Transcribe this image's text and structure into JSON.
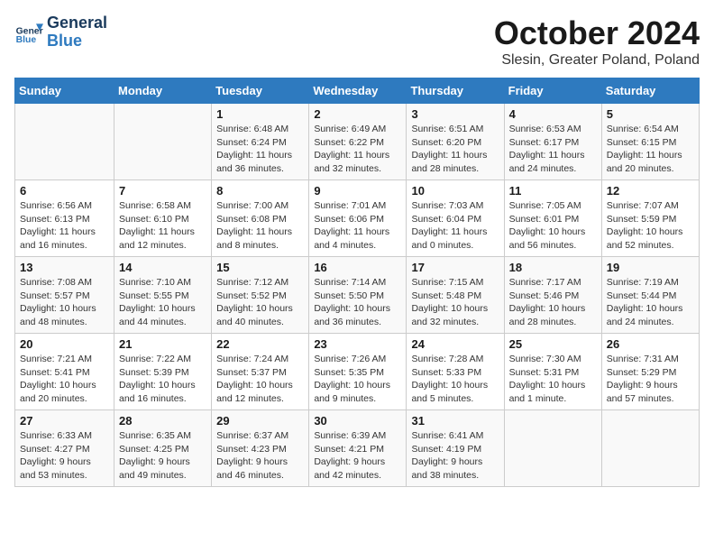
{
  "header": {
    "logo_line1": "General",
    "logo_line2": "Blue",
    "month": "October 2024",
    "location": "Slesin, Greater Poland, Poland"
  },
  "days_of_week": [
    "Sunday",
    "Monday",
    "Tuesday",
    "Wednesday",
    "Thursday",
    "Friday",
    "Saturday"
  ],
  "weeks": [
    [
      {
        "day": "",
        "info": ""
      },
      {
        "day": "",
        "info": ""
      },
      {
        "day": "1",
        "info": "Sunrise: 6:48 AM\nSunset: 6:24 PM\nDaylight: 11 hours and 36 minutes."
      },
      {
        "day": "2",
        "info": "Sunrise: 6:49 AM\nSunset: 6:22 PM\nDaylight: 11 hours and 32 minutes."
      },
      {
        "day": "3",
        "info": "Sunrise: 6:51 AM\nSunset: 6:20 PM\nDaylight: 11 hours and 28 minutes."
      },
      {
        "day": "4",
        "info": "Sunrise: 6:53 AM\nSunset: 6:17 PM\nDaylight: 11 hours and 24 minutes."
      },
      {
        "day": "5",
        "info": "Sunrise: 6:54 AM\nSunset: 6:15 PM\nDaylight: 11 hours and 20 minutes."
      }
    ],
    [
      {
        "day": "6",
        "info": "Sunrise: 6:56 AM\nSunset: 6:13 PM\nDaylight: 11 hours and 16 minutes."
      },
      {
        "day": "7",
        "info": "Sunrise: 6:58 AM\nSunset: 6:10 PM\nDaylight: 11 hours and 12 minutes."
      },
      {
        "day": "8",
        "info": "Sunrise: 7:00 AM\nSunset: 6:08 PM\nDaylight: 11 hours and 8 minutes."
      },
      {
        "day": "9",
        "info": "Sunrise: 7:01 AM\nSunset: 6:06 PM\nDaylight: 11 hours and 4 minutes."
      },
      {
        "day": "10",
        "info": "Sunrise: 7:03 AM\nSunset: 6:04 PM\nDaylight: 11 hours and 0 minutes."
      },
      {
        "day": "11",
        "info": "Sunrise: 7:05 AM\nSunset: 6:01 PM\nDaylight: 10 hours and 56 minutes."
      },
      {
        "day": "12",
        "info": "Sunrise: 7:07 AM\nSunset: 5:59 PM\nDaylight: 10 hours and 52 minutes."
      }
    ],
    [
      {
        "day": "13",
        "info": "Sunrise: 7:08 AM\nSunset: 5:57 PM\nDaylight: 10 hours and 48 minutes."
      },
      {
        "day": "14",
        "info": "Sunrise: 7:10 AM\nSunset: 5:55 PM\nDaylight: 10 hours and 44 minutes."
      },
      {
        "day": "15",
        "info": "Sunrise: 7:12 AM\nSunset: 5:52 PM\nDaylight: 10 hours and 40 minutes."
      },
      {
        "day": "16",
        "info": "Sunrise: 7:14 AM\nSunset: 5:50 PM\nDaylight: 10 hours and 36 minutes."
      },
      {
        "day": "17",
        "info": "Sunrise: 7:15 AM\nSunset: 5:48 PM\nDaylight: 10 hours and 32 minutes."
      },
      {
        "day": "18",
        "info": "Sunrise: 7:17 AM\nSunset: 5:46 PM\nDaylight: 10 hours and 28 minutes."
      },
      {
        "day": "19",
        "info": "Sunrise: 7:19 AM\nSunset: 5:44 PM\nDaylight: 10 hours and 24 minutes."
      }
    ],
    [
      {
        "day": "20",
        "info": "Sunrise: 7:21 AM\nSunset: 5:41 PM\nDaylight: 10 hours and 20 minutes."
      },
      {
        "day": "21",
        "info": "Sunrise: 7:22 AM\nSunset: 5:39 PM\nDaylight: 10 hours and 16 minutes."
      },
      {
        "day": "22",
        "info": "Sunrise: 7:24 AM\nSunset: 5:37 PM\nDaylight: 10 hours and 12 minutes."
      },
      {
        "day": "23",
        "info": "Sunrise: 7:26 AM\nSunset: 5:35 PM\nDaylight: 10 hours and 9 minutes."
      },
      {
        "day": "24",
        "info": "Sunrise: 7:28 AM\nSunset: 5:33 PM\nDaylight: 10 hours and 5 minutes."
      },
      {
        "day": "25",
        "info": "Sunrise: 7:30 AM\nSunset: 5:31 PM\nDaylight: 10 hours and 1 minute."
      },
      {
        "day": "26",
        "info": "Sunrise: 7:31 AM\nSunset: 5:29 PM\nDaylight: 9 hours and 57 minutes."
      }
    ],
    [
      {
        "day": "27",
        "info": "Sunrise: 6:33 AM\nSunset: 4:27 PM\nDaylight: 9 hours and 53 minutes."
      },
      {
        "day": "28",
        "info": "Sunrise: 6:35 AM\nSunset: 4:25 PM\nDaylight: 9 hours and 49 minutes."
      },
      {
        "day": "29",
        "info": "Sunrise: 6:37 AM\nSunset: 4:23 PM\nDaylight: 9 hours and 46 minutes."
      },
      {
        "day": "30",
        "info": "Sunrise: 6:39 AM\nSunset: 4:21 PM\nDaylight: 9 hours and 42 minutes."
      },
      {
        "day": "31",
        "info": "Sunrise: 6:41 AM\nSunset: 4:19 PM\nDaylight: 9 hours and 38 minutes."
      },
      {
        "day": "",
        "info": ""
      },
      {
        "day": "",
        "info": ""
      }
    ]
  ]
}
